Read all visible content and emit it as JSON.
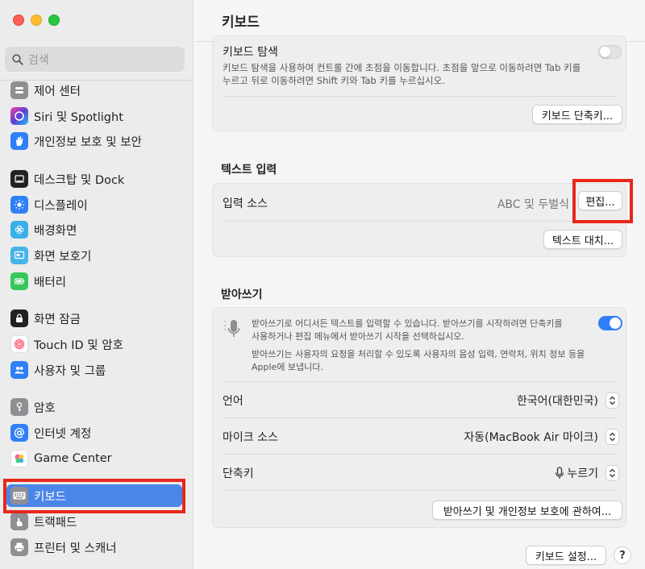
{
  "sidebar": {
    "search_placeholder": "검색",
    "items": [
      {
        "label": "제어 센터",
        "icon": "control-center-icon",
        "color": "#8e8e93"
      },
      {
        "label": "Siri 및 Spotlight",
        "icon": "siri-icon",
        "color": "#5b3fd6"
      },
      {
        "label": "개인정보 보호 및 보안",
        "icon": "hand-icon",
        "color": "#2f7ff7"
      },
      {
        "label": "데스크탑 및 Dock",
        "icon": "dock-icon",
        "color": "#222222"
      },
      {
        "label": "디스플레이",
        "icon": "sun-icon",
        "color": "#2f7ff7"
      },
      {
        "label": "배경화면",
        "icon": "flower-icon",
        "color": "#3ab0e8"
      },
      {
        "label": "화면 보호기",
        "icon": "screensaver-icon",
        "color": "#45b4e8"
      },
      {
        "label": "배터리",
        "icon": "battery-icon",
        "color": "#35c759"
      },
      {
        "label": "화면 잠금",
        "icon": "lock-icon",
        "color": "#222222"
      },
      {
        "label": "Touch ID 및 암호",
        "icon": "fingerprint-icon",
        "color": "#ffffff"
      },
      {
        "label": "사용자 및 그룹",
        "icon": "users-icon",
        "color": "#2f7ff7"
      },
      {
        "label": "암호",
        "icon": "key-icon",
        "color": "#8e8e93"
      },
      {
        "label": "인터넷 계정",
        "icon": "at-icon",
        "color": "#2f7ff7"
      },
      {
        "label": "Game Center",
        "icon": "game-center-icon",
        "color": "#ffffff"
      },
      {
        "label": "키보드",
        "icon": "keyboard-icon",
        "color": "#8e8e93"
      },
      {
        "label": "트랙패드",
        "icon": "trackpad-icon",
        "color": "#8e8e93"
      },
      {
        "label": "프린터 및 스캐너",
        "icon": "printer-icon",
        "color": "#8e8e93"
      }
    ],
    "selected_index": 14
  },
  "main": {
    "title": "키보드",
    "keyboard_nav": {
      "title": "키보드 탐색",
      "description_line1": "키보드 탐색을 사용하여 컨트롤 간에 초점을 이동합니다. 초점을 앞으로 이동하려면 Tab 키를",
      "description_line2": "누르고 뒤로 이동하려면 Shift 키와 Tab 키를 누르십시오.",
      "enabled": false,
      "shortcuts_button": "키보드 단축키..."
    },
    "text_input": {
      "section_title": "텍스트 입력",
      "input_sources_label": "입력 소스",
      "input_sources_value": "ABC 및 두벌식",
      "edit_button": "편집...",
      "text_replacement_button": "텍스트 대치..."
    },
    "dictation": {
      "section_title": "받아쓰기",
      "enabled": true,
      "description_line1": "받아쓰기로 어디서든 텍스트를 입력할 수 있습니다. 받아쓰기를 시작하려면 단축키를",
      "description_line2": "사용하거나 편집 메뉴에서 받아쓰기 시작을 선택하십시오.",
      "privacy_line1": "받아쓰기는 사용자의 요청을 처리할 수 있도록 사용자의 음성 입력, 연락처, 위치 정보 등을",
      "privacy_line2": "Apple에 보냅니다.",
      "language_label": "언어",
      "language_value": "한국어(대한민국)",
      "mic_source_label": "마이크 소스",
      "mic_source_value": "자동(MacBook Air 마이크)",
      "shortcut_label": "단축키",
      "shortcut_value": "누르기",
      "about_button": "받아쓰기 및 개인정보 보호에 관하여..."
    },
    "keyboard_settings_button": "키보드 설정...",
    "help_button": "?"
  },
  "colors": {
    "accent": "#2f7ff7",
    "highlight_outline": "#e8271a",
    "selected_row": "#4a86e8"
  }
}
